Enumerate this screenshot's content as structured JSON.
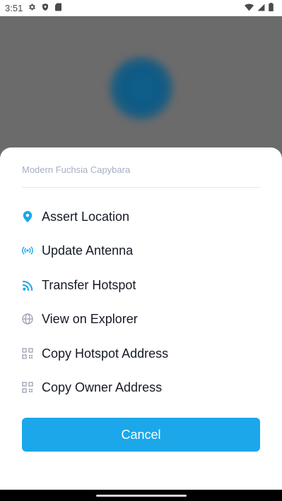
{
  "status_bar": {
    "time": "3:51",
    "icons": [
      "gear-icon",
      "shield-icon",
      "sd-card-icon",
      "wifi-icon",
      "cell-signal-icon",
      "battery-icon"
    ]
  },
  "sheet": {
    "title": "Modern Fuchsia Capybara",
    "items": [
      {
        "label": "Assert Location",
        "icon": "location-pin-icon"
      },
      {
        "label": "Update Antenna",
        "icon": "antenna-icon"
      },
      {
        "label": "Transfer Hotspot",
        "icon": "transfer-signal-icon"
      },
      {
        "label": "View on Explorer",
        "icon": "globe-icon"
      },
      {
        "label": "Copy Hotspot Address",
        "icon": "qr-code-icon"
      },
      {
        "label": "Copy Owner Address",
        "icon": "qr-code-icon"
      }
    ],
    "cancel_label": "Cancel"
  },
  "colors": {
    "accent": "#1ba7ea",
    "icon_blue": "#1ba7ea",
    "icon_gray": "#9aa0b4",
    "overlay": "#6b6b6b",
    "text": "#151a26",
    "subtitle": "#a7aec4"
  }
}
